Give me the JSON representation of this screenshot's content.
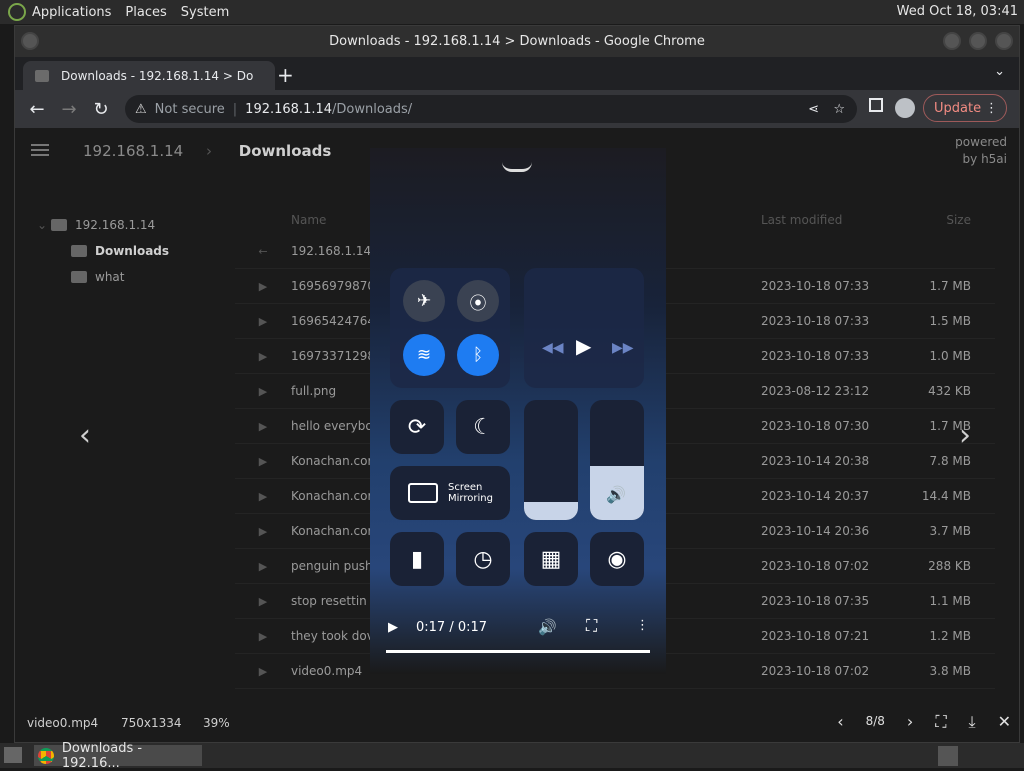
{
  "panel": {
    "menus": [
      "Applications",
      "Places",
      "System"
    ],
    "clock": "Wed Oct 18, 03:41"
  },
  "window": {
    "title": "Downloads - 192.168.1.14 > Downloads - Google Chrome"
  },
  "tab": {
    "label": "Downloads - 192.168.1.14 > Do",
    "close": "×"
  },
  "new_tab": "+",
  "tab_menu": "⌄",
  "toolbar": {
    "back": "←",
    "forward": "→",
    "reload": "↻",
    "not_secure": "Not secure",
    "host": "192.168.1.14",
    "path": "/Downloads/",
    "update_label": "Update",
    "more": "⋮"
  },
  "breadcrumb": {
    "root": "192.168.1.14",
    "current": "Downloads"
  },
  "powered": [
    "powered",
    "by h5ai"
  ],
  "tree": [
    {
      "label": "192.168.1.14",
      "bold": false
    },
    {
      "label": "Downloads",
      "bold": true
    },
    {
      "label": "what",
      "bold": false
    }
  ],
  "columns": {
    "name": "Name",
    "modified": "Last modified",
    "size": "Size"
  },
  "parent_row": "192.168.1.14",
  "files": [
    {
      "name": "16956979870",
      "date": "2023-10-18 07:33",
      "size": "1.7 MB"
    },
    {
      "name": "16965424764",
      "date": "2023-10-18 07:33",
      "size": "1.5 MB"
    },
    {
      "name": "16973371298",
      "date": "2023-10-18 07:33",
      "size": "1.0 MB"
    },
    {
      "name": "full.png",
      "date": "2023-08-12 23:12",
      "size": "432 KB"
    },
    {
      "name": "hello everybo",
      "date": "2023-10-18 07:30",
      "size": "1.7 MB"
    },
    {
      "name": "Konachan.cor … hive blue…",
      "date": "2023-10-14 20:38",
      "size": "7.8 MB"
    },
    {
      "name": "Konachan.cor … hair gro…",
      "date": "2023-10-14 20:37",
      "size": "14.4 MB"
    },
    {
      "name": "Konachan.cor … niku hea…",
      "date": "2023-10-14 20:36",
      "size": "3.7 MB"
    },
    {
      "name": "penguin push",
      "date": "2023-10-18 07:02",
      "size": "288 KB"
    },
    {
      "name": "stop resettin",
      "date": "2023-10-18 07:35",
      "size": "1.1 MB"
    },
    {
      "name": "they took dov",
      "date": "2023-10-18 07:21",
      "size": "1.2 MB"
    },
    {
      "name": "video0.mp4",
      "date": "2023-10-18 07:02",
      "size": "3.8 MB"
    }
  ],
  "viewer": {
    "mirroring_label": [
      "Screen",
      "Mirroring"
    ],
    "time": "0:17 / 0:17",
    "brightness_level": 0.15,
    "volume_level": 0.45
  },
  "statusbar": {
    "filename": "video0.mp4",
    "dimensions": "750x1334",
    "zoom": "39%",
    "counter": "8/8"
  },
  "taskbar": {
    "window_label": "Downloads - 192.16..."
  }
}
